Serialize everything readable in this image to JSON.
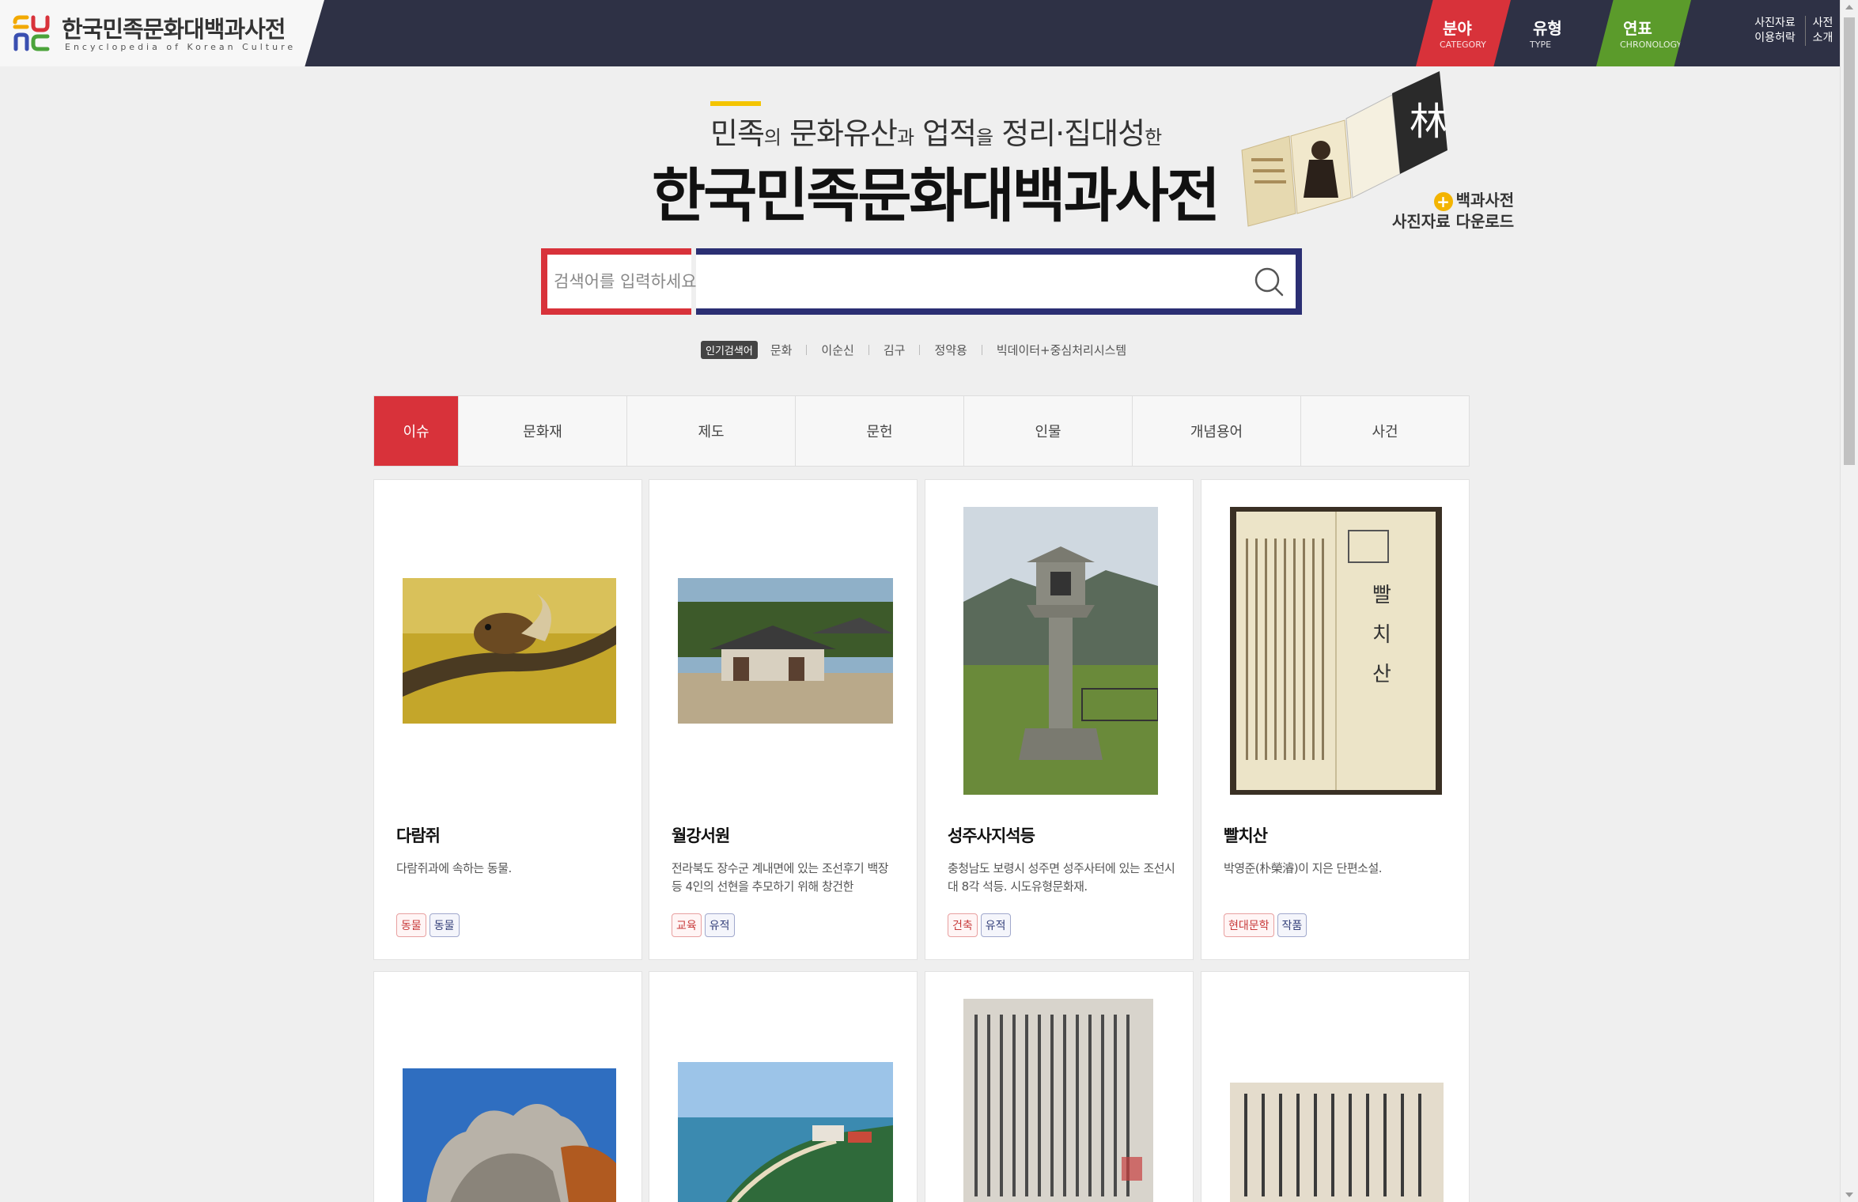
{
  "header": {
    "logo_title": "한국민족문화대백과사전",
    "logo_sub": "Encyclopedia of Korean Culture",
    "nav": [
      {
        "label": "분야",
        "sub": "CATEGORY"
      },
      {
        "label": "유형",
        "sub": "TYPE"
      },
      {
        "label": "연표",
        "sub": "CHRONOLOGY"
      }
    ],
    "util_photo": [
      "사진자료",
      "이용허락"
    ],
    "util_about": [
      "사전",
      "소개"
    ]
  },
  "hero": {
    "tagline": [
      {
        "big": "민족",
        "small": "의"
      },
      {
        "big": " 문화유산",
        "small": "과"
      },
      {
        "big": " 업적",
        "small": "을"
      },
      {
        "big": " 정리·집대성",
        "small": "한"
      }
    ],
    "title": "한국민족문화대백과사전",
    "promo_line1": "백과사전",
    "promo_line2": "사진자료 다운로드"
  },
  "search": {
    "placeholder": "검색어를 입력하세요"
  },
  "popular": {
    "label": "인기검색어",
    "items": [
      "문화",
      "이순신",
      "김구",
      "정약용",
      "빅데이터+중심처리시스템"
    ]
  },
  "tabs": [
    "이슈",
    "문화재",
    "제도",
    "문헌",
    "인물",
    "개념용어",
    "사건"
  ],
  "cards": [
    {
      "title": "다람쥐",
      "desc": "다람쥐과에 속하는 동물.",
      "tags": [
        "동물",
        "동물"
      ]
    },
    {
      "title": "월강서원",
      "desc": "전라북도 장수군 계내면에 있는 조선후기 백장 등 4인의 선현을 추모하기 위해 창건한",
      "tags": [
        "교육",
        "유적"
      ]
    },
    {
      "title": "성주사지석등",
      "desc": "충청남도 보령시 성주면 성주사터에 있는 조선시대 8각 석등. 시도유형문화재.",
      "tags": [
        "건축",
        "유적"
      ]
    },
    {
      "title": "빨치산",
      "desc": "박영준(朴榮濬)이 지은 단편소설.",
      "tags": [
        "현대문학",
        "작품"
      ]
    }
  ],
  "colors": {
    "navy": "#2e3145",
    "red": "#d8323a",
    "green": "#5b9b2b",
    "search_navy": "#2b2f73",
    "accent_yellow": "#f4c400"
  }
}
